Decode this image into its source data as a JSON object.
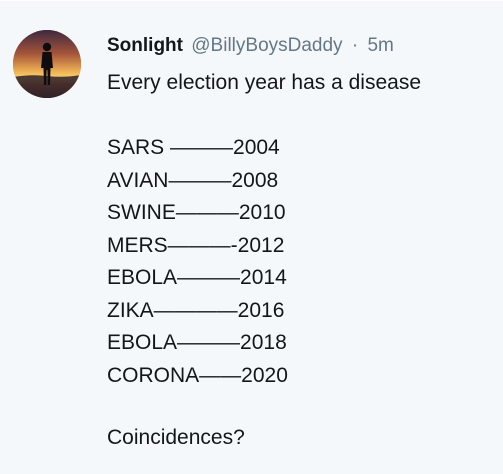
{
  "tweet": {
    "display_name": "Sonlight",
    "handle": "@BillyBoysDaddy",
    "separator": "·",
    "timestamp": "5m",
    "text_intro": "Every election year has a disease",
    "list": [
      "SARS ———2004",
      "AVIAN———2008",
      "SWINE———2010",
      "MERS———-2012",
      "EBOLA———2014",
      "ZIKA————2016",
      "EBOLA———2018",
      "CORONA——2020"
    ],
    "closing": "Coincidences?"
  },
  "colors": {
    "background": "#f5f8fa",
    "text": "#14171a",
    "secondary_text": "#657786"
  }
}
